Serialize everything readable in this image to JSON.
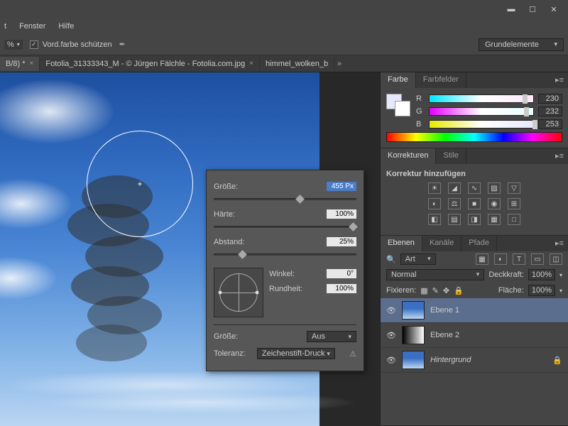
{
  "menu": {
    "items": [
      "t",
      "Fenster",
      "Hilfe"
    ]
  },
  "optbar": {
    "percent": "%",
    "vord": "Vord.farbe schützen"
  },
  "workspace": {
    "label": "Grundelemente"
  },
  "tabs": [
    {
      "label": "B/8) *",
      "active": true
    },
    {
      "label": "Fotolia_31333343_M - © Jürgen Fälchle - Fotolia.com.jpg",
      "active": false
    },
    {
      "label": "himmel_wolken_b",
      "active": false
    }
  ],
  "brushPopup": {
    "size_label": "Größe:",
    "size_val": "455 Px",
    "size_pct": 58,
    "hard_label": "Härte:",
    "hard_val": "100%",
    "hard_pct": 100,
    "space_label": "Abstand:",
    "space_val": "25%",
    "space_pct": 18,
    "angle_label": "Winkel:",
    "angle_val": "0°",
    "round_label": "Rundheit:",
    "round_val": "100%",
    "size2_label": "Größe:",
    "size2_sel": "Aus",
    "tol_label": "Toleranz:",
    "tol_sel": "Zeichenstift-Druck"
  },
  "farbe": {
    "tab1": "Farbe",
    "tab2": "Farbfelder",
    "r": "R",
    "g": "G",
    "b": "B",
    "rv": "230",
    "gv": "232",
    "bv": "253",
    "rp": 90,
    "gp": 91,
    "bp": 99
  },
  "korr": {
    "tab1": "Korrekturen",
    "tab2": "Stile",
    "title": "Korrektur hinzufügen"
  },
  "ebenen": {
    "tab1": "Ebenen",
    "tab2": "Kanäle",
    "tab3": "Pfade",
    "filter": "Art",
    "blend": "Normal",
    "deck_label": "Deckkraft:",
    "deck_val": "100%",
    "fix_label": "Fixieren:",
    "flache_label": "Fläche:",
    "flache_val": "100%",
    "layers": [
      {
        "name": "Ebene 1",
        "sel": true,
        "th": "sky1"
      },
      {
        "name": "Ebene 2",
        "sel": false,
        "th": "grad"
      },
      {
        "name": "Hintergrund",
        "sel": false,
        "th": "sky1",
        "locked": true,
        "italic": true
      }
    ]
  }
}
